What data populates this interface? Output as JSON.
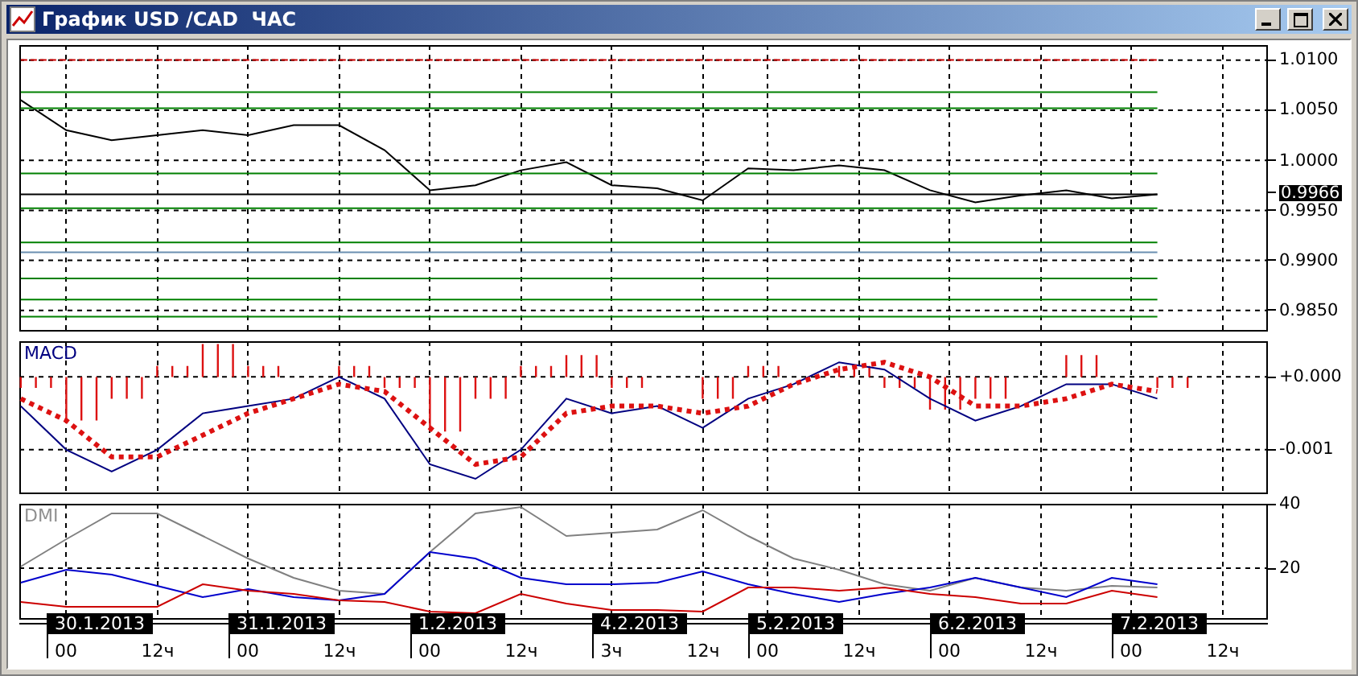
{
  "window": {
    "title": "График USD /CAD  ЧАС",
    "buttons": [
      {
        "kind": "minimize"
      },
      {
        "kind": "maximize"
      },
      {
        "kind": "close"
      }
    ]
  },
  "panes": [
    {
      "kind": "price",
      "chart_data": {
        "type": "line",
        "grid": true,
        "categories": [
          null,
          null,
          null,
          null,
          null,
          null,
          null,
          null,
          null,
          null,
          null,
          null,
          null,
          null,
          null,
          null,
          null,
          null,
          null,
          null,
          null,
          null,
          null,
          null,
          null,
          null
        ],
        "ylim": [
          0.9829,
          1.0115
        ],
        "yticks": [
          {
            "value": 1.01,
            "label": "1.0100"
          },
          {
            "value": 1.005,
            "label": "1.0050"
          },
          {
            "value": 1.0,
            "label": "1.0000"
          },
          {
            "value": 0.995,
            "label": "0.9950"
          },
          {
            "value": 0.99,
            "label": "0.9900"
          },
          {
            "value": 0.985,
            "label": "0.9850"
          }
        ],
        "series": [
          {
            "color": "#000000",
            "values": [
              1.006,
              1.003,
              1.002,
              1.0025,
              1.003,
              1.0025,
              1.0035,
              1.0035,
              1.001,
              0.997,
              0.9975,
              0.999,
              0.9998,
              0.9975,
              0.9972,
              0.996,
              0.9992,
              0.999,
              0.9995,
              0.999,
              0.997,
              0.9958,
              0.9965,
              0.997,
              0.9962,
              0.9966
            ]
          },
          {
            "color": "#cc0000",
            "line_style": "dashed",
            "values": [
              1.01,
              1.01,
              1.01,
              1.01,
              1.01,
              1.01,
              1.01,
              1.01,
              1.01,
              1.01,
              1.01,
              1.01,
              1.01,
              1.01,
              1.01,
              1.01,
              1.01,
              1.01,
              1.01,
              1.01,
              1.01,
              1.01,
              1.01,
              1.01,
              1.01,
              1.01
            ]
          },
          {
            "color": "#008000",
            "values": [
              1.0068,
              1.0068,
              1.0068,
              1.0068,
              1.0068,
              1.0068,
              1.0068,
              1.0068,
              1.0068,
              1.0068,
              1.0068,
              1.0068,
              1.0068,
              1.0068,
              1.0068,
              1.0068,
              1.0068,
              1.0068,
              1.0068,
              1.0068,
              1.0068,
              1.0068,
              1.0068,
              1.0068,
              1.0068,
              1.0068
            ]
          },
          {
            "color": "#008000",
            "values": [
              1.0052,
              1.0052,
              1.0052,
              1.0052,
              1.0052,
              1.0052,
              1.0052,
              1.0052,
              1.0052,
              1.0052,
              1.0052,
              1.0052,
              1.0052,
              1.0052,
              1.0052,
              1.0052,
              1.0052,
              1.0052,
              1.0052,
              1.0052,
              1.0052,
              1.0052,
              1.0052,
              1.0052,
              1.0052,
              1.0052
            ]
          },
          {
            "color": "#008000",
            "values": [
              0.9987,
              0.9987,
              0.9987,
              0.9987,
              0.9987,
              0.9987,
              0.9987,
              0.9987,
              0.9987,
              0.9987,
              0.9987,
              0.9987,
              0.9987,
              0.9987,
              0.9987,
              0.9987,
              0.9987,
              0.9987,
              0.9987,
              0.9987,
              0.9987,
              0.9987,
              0.9987,
              0.9987,
              0.9987,
              0.9987
            ]
          },
          {
            "color": "#000000",
            "values": [
              0.9966,
              0.9966,
              0.9966,
              0.9966,
              0.9966,
              0.9966,
              0.9966,
              0.9966,
              0.9966,
              0.9966,
              0.9966,
              0.9966,
              0.9966,
              0.9966,
              0.9966,
              0.9966,
              0.9966,
              0.9966,
              0.9966,
              0.9966,
              0.9966,
              0.9966,
              0.9966,
              0.9966,
              0.9966,
              0.9966
            ]
          },
          {
            "color": "#008000",
            "values": [
              0.9952,
              0.9952,
              0.9952,
              0.9952,
              0.9952,
              0.9952,
              0.9952,
              0.9952,
              0.9952,
              0.9952,
              0.9952,
              0.9952,
              0.9952,
              0.9952,
              0.9952,
              0.9952,
              0.9952,
              0.9952,
              0.9952,
              0.9952,
              0.9952,
              0.9952,
              0.9952,
              0.9952,
              0.9952,
              0.9952
            ]
          },
          {
            "color": "#008000",
            "values": [
              0.9918,
              0.9918,
              0.9918,
              0.9918,
              0.9918,
              0.9918,
              0.9918,
              0.9918,
              0.9918,
              0.9918,
              0.9918,
              0.9918,
              0.9918,
              0.9918,
              0.9918,
              0.9918,
              0.9918,
              0.9918,
              0.9918,
              0.9918,
              0.9918,
              0.9918,
              0.9918,
              0.9918,
              0.9918,
              0.9918
            ]
          },
          {
            "color": "#6a8fb0",
            "values": [
              0.9908,
              0.9908,
              0.9908,
              0.9908,
              0.9908,
              0.9908,
              0.9908,
              0.9908,
              0.9908,
              0.9908,
              0.9908,
              0.9908,
              0.9908,
              0.9908,
              0.9908,
              0.9908,
              0.9908,
              0.9908,
              0.9908,
              0.9908,
              0.9908,
              0.9908,
              0.9908,
              0.9908,
              0.9908,
              0.9908
            ]
          },
          {
            "color": "#008000",
            "values": [
              0.9882,
              0.9882,
              0.9882,
              0.9882,
              0.9882,
              0.9882,
              0.9882,
              0.9882,
              0.9882,
              0.9882,
              0.9882,
              0.9882,
              0.9882,
              0.9882,
              0.9882,
              0.9882,
              0.9882,
              0.9882,
              0.9882,
              0.9882,
              0.9882,
              0.9882,
              0.9882,
              0.9882,
              0.9882,
              0.9882
            ]
          },
          {
            "color": "#008000",
            "values": [
              0.9861,
              0.9861,
              0.9861,
              0.9861,
              0.9861,
              0.9861,
              0.9861,
              0.9861,
              0.9861,
              0.9861,
              0.9861,
              0.9861,
              0.9861,
              0.9861,
              0.9861,
              0.9861,
              0.9861,
              0.9861,
              0.9861,
              0.9861,
              0.9861,
              0.9861,
              0.9861,
              0.9861,
              0.9861,
              0.9861
            ]
          },
          {
            "color": "#008000",
            "values": [
              0.9844,
              0.9844,
              0.9844,
              0.9844,
              0.9844,
              0.9844,
              0.9844,
              0.9844,
              0.9844,
              0.9844,
              0.9844,
              0.9844,
              0.9844,
              0.9844,
              0.9844,
              0.9844,
              0.9844,
              0.9844,
              0.9844,
              0.9844,
              0.9844,
              0.9844,
              0.9844,
              0.9844,
              0.9844,
              0.9844
            ]
          }
        ]
      },
      "price_label": "0.9966"
    },
    {
      "kind": "macd",
      "label": "MACD",
      "chart_data": {
        "type": "line",
        "grid": true,
        "categories": [
          null,
          null,
          null,
          null,
          null,
          null,
          null,
          null,
          null,
          null,
          null,
          null,
          null,
          null,
          null,
          null,
          null,
          null,
          null,
          null,
          null,
          null,
          null,
          null,
          null,
          null
        ],
        "ylim": [
          -0.00161,
          0.00049
        ],
        "yticks": [
          {
            "value": 0,
            "label": "+0.000"
          },
          {
            "value": -0.001,
            "label": "-0.001"
          }
        ],
        "series": [
          {
            "color": "#000080",
            "values": [
              -0.0004,
              -0.001,
              -0.0013,
              -0.001,
              -0.0005,
              -0.0004,
              -0.0003,
              0,
              -0.0003,
              -0.0012,
              -0.0014,
              -0.001,
              -0.0003,
              -0.0005,
              -0.0004,
              -0.0007,
              -0.0003,
              -0.0001,
              0.0002,
              0.0001,
              -0.0003,
              -0.0006,
              -0.0004,
              -0.0001,
              -0.0001,
              -0.0003
            ]
          },
          {
            "color": "#dd1111",
            "line_style": "dotted",
            "values": [
              -0.0003,
              -0.0006,
              -0.0011,
              -0.0011,
              -0.0008,
              -0.0005,
              -0.0003,
              -0.0001,
              -0.0002,
              -0.0007,
              -0.0012,
              -0.0011,
              -0.0005,
              -0.0004,
              -0.0004,
              -0.0005,
              -0.0004,
              -0.0001,
              0.0001,
              0.0002,
              0,
              -0.0004,
              -0.0004,
              -0.0003,
              -0.0001,
              -0.0002
            ]
          }
        ]
      }
    },
    {
      "kind": "dmi",
      "label": "DMI",
      "chart_data": {
        "type": "line",
        "grid": true,
        "categories": [
          null,
          null,
          null,
          null,
          null,
          null,
          null,
          null,
          null,
          null,
          null,
          null,
          null,
          null,
          null,
          null,
          null,
          null,
          null,
          null,
          null,
          null,
          null,
          null,
          null,
          null
        ],
        "ylim": [
          4,
          40
        ],
        "yticks": [
          {
            "value": 40,
            "label": "40"
          },
          {
            "value": 20,
            "label": "20"
          }
        ],
        "series": [
          {
            "color": "#808080",
            "values": [
              20.5,
              29,
              37,
              37,
              30,
              23,
              17,
              13,
              12,
              25,
              37,
              39,
              30,
              31,
              32,
              38,
              30,
              23,
              19.5,
              15,
              13,
              17,
              14,
              13,
              14.5,
              14
            ]
          },
          {
            "color": "#0000cc",
            "values": [
              15.5,
              19.5,
              18,
              14.5,
              11,
              13.5,
              11,
              10,
              12,
              25,
              23,
              17,
              15,
              15,
              15.5,
              19,
              15,
              12,
              9.5,
              12,
              14,
              17,
              14,
              11,
              17,
              15
            ]
          },
          {
            "color": "#cc0000",
            "values": [
              9.5,
              8,
              8,
              8,
              15,
              13,
              12,
              10,
              9.5,
              6.5,
              6,
              12,
              9,
              7,
              7,
              6.5,
              14,
              14,
              13,
              14,
              12,
              11,
              9,
              9,
              13,
              11
            ]
          }
        ]
      }
    }
  ],
  "time_axis": {
    "dates": [
      "30.1.2013",
      "31.1.2013",
      "1.2.2013",
      "4.2.2013",
      "5.2.2013",
      "6.2.2013",
      "7.2.2013"
    ],
    "hours": [
      "00",
      "12ч",
      "00",
      "12ч",
      "00",
      "12ч",
      "3ч",
      "12ч",
      "00",
      "12ч",
      "00",
      "12ч",
      "00",
      "12ч"
    ]
  }
}
